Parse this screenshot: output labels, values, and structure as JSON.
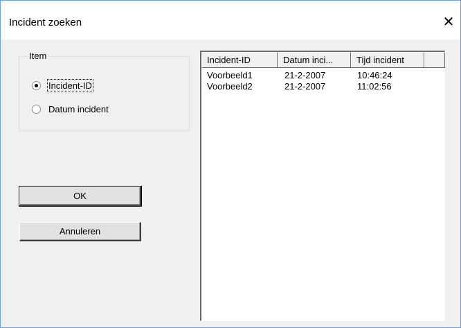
{
  "window": {
    "title": "Incident zoeken",
    "close_glyph": "✕"
  },
  "group": {
    "label": "Item",
    "options": [
      {
        "label": "Incident-ID",
        "selected": true
      },
      {
        "label": "Datum incident",
        "selected": false
      }
    ]
  },
  "buttons": {
    "ok": "OK",
    "cancel": "Annuleren"
  },
  "list": {
    "columns": [
      "Incident-ID",
      "Datum inci...",
      "Tijd incident",
      ""
    ],
    "rows": [
      [
        "Voorbeeld1",
        "21-2-2007",
        "10:46:24"
      ],
      [
        "Voorbeeld2",
        "21-2-2007",
        "11:02:56"
      ]
    ]
  }
}
